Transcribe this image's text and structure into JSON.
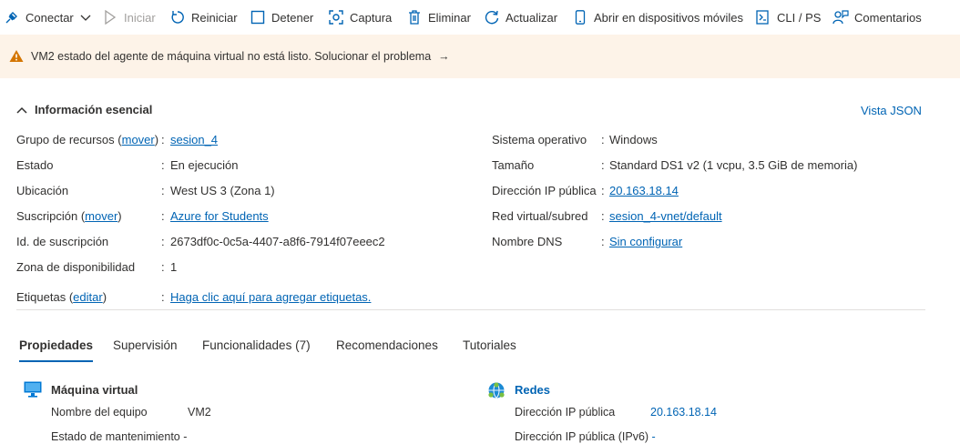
{
  "toolbar": {
    "connect": "Conectar",
    "start": "Iniciar",
    "restart": "Reiniciar",
    "stop": "Detener",
    "capture": "Captura",
    "delete": "Eliminar",
    "refresh": "Actualizar",
    "mobile": "Abrir en dispositivos móviles",
    "cli": "CLI / PS",
    "feedback": "Comentarios"
  },
  "banner": {
    "message": "VM2 estado del agente de máquina virtual no está listo. Solucionar el problema",
    "arrow": "→"
  },
  "essentials": {
    "title": "Información esencial",
    "json_view": "Vista JSON",
    "left": [
      {
        "label": "Grupo de recursos",
        "action": "mover",
        "value": "sesion_4",
        "link": true
      },
      {
        "label": "Estado",
        "value": "En ejecución",
        "link": false
      },
      {
        "label": "Ubicación",
        "value": "West US 3 (Zona 1)",
        "link": false
      },
      {
        "label": "Suscripción",
        "action": "mover",
        "value": "Azure for Students",
        "link": true
      },
      {
        "label": "Id. de suscripción",
        "value": "2673df0c-0c5a-4407-a8f6-7914f07eeec2",
        "link": false
      },
      {
        "label": "Zona de disponibilidad",
        "value": "1",
        "link": false
      }
    ],
    "right": [
      {
        "label": "Sistema operativo",
        "value": "Windows",
        "link": false
      },
      {
        "label": "Tamaño",
        "value": "Standard DS1 v2 (1 vcpu, 3.5 GiB de memoria)",
        "link": false
      },
      {
        "label": "Dirección IP pública",
        "value": "20.163.18.14",
        "link": true
      },
      {
        "label": "Red virtual/subred",
        "value": "sesion_4-vnet/default",
        "link": true
      },
      {
        "label": "Nombre DNS",
        "value": "Sin configurar",
        "link": true
      }
    ],
    "tags": {
      "label": "Etiquetas",
      "action": "editar",
      "value": "Haga clic aquí para agregar etiquetas."
    }
  },
  "tabs": [
    "Propiedades",
    "Supervisión",
    "Funcionalidades (7)",
    "Recomendaciones",
    "Tutoriales"
  ],
  "active_tab": "Propiedades",
  "vm_section": {
    "title": "Máquina virtual",
    "rows": [
      {
        "label": "Nombre del equipo",
        "value": "VM2"
      },
      {
        "label": "Estado de mantenimiento",
        "value": "-"
      }
    ]
  },
  "net_section": {
    "title": "Redes",
    "rows": [
      {
        "label": "Dirección IP pública",
        "value": "20.163.18.14"
      },
      {
        "label": "Dirección IP pública (IPv6)",
        "value": "-"
      }
    ]
  },
  "colors": {
    "accent": "#0064b4",
    "banner_bg": "#fdf3e8",
    "warning": "#d47500"
  }
}
